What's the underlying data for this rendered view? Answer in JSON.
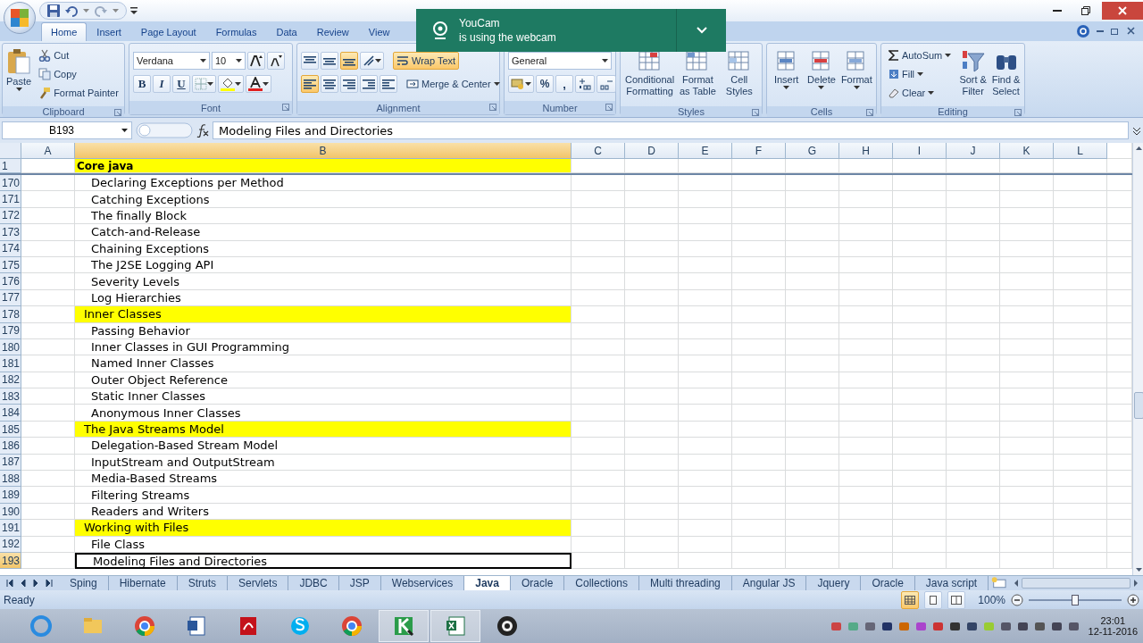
{
  "toast": {
    "title": "YouCam",
    "message": "is using the webcam"
  },
  "ribbon_tabs": [
    {
      "label": "Home",
      "selected": true
    },
    {
      "label": "Insert",
      "selected": false
    },
    {
      "label": "Page Layout",
      "selected": false
    },
    {
      "label": "Formulas",
      "selected": false
    },
    {
      "label": "Data",
      "selected": false
    },
    {
      "label": "Review",
      "selected": false
    },
    {
      "label": "View",
      "selected": false
    }
  ],
  "ribbon": {
    "clipboard": {
      "label": "Clipboard",
      "paste": "Paste",
      "cut": "Cut",
      "copy": "Copy",
      "format_painter": "Format Painter"
    },
    "font": {
      "label": "Font",
      "font_name": "Verdana",
      "font_size": "10",
      "bold": "B",
      "italic": "I",
      "underline": "U"
    },
    "alignment": {
      "label": "Alignment",
      "wrap_text": "Wrap Text",
      "merge_center": "Merge & Center"
    },
    "number": {
      "label": "Number",
      "format": "General",
      "percent": "%",
      "comma": ","
    },
    "styles": {
      "label": "Styles",
      "buttons": [
        [
          "Conditional",
          "Formatting"
        ],
        [
          "Format",
          "as Table"
        ],
        [
          "Cell",
          "Styles"
        ]
      ]
    },
    "cells": {
      "label": "Cells",
      "buttons": [
        "Insert",
        "Delete",
        "Format"
      ]
    },
    "editing": {
      "label": "Editing",
      "autosum": "AutoSum",
      "fill": "Fill",
      "clear": "Clear",
      "buttons": [
        [
          "Sort &",
          "Filter"
        ],
        [
          "Find &",
          "Select"
        ]
      ]
    }
  },
  "formula_bar": {
    "name_box": "B193",
    "formula": "Modeling Files and Directories"
  },
  "columns": [
    {
      "label": "A",
      "selected": false
    },
    {
      "label": "B",
      "selected": true
    },
    {
      "label": "C",
      "selected": false
    },
    {
      "label": "D",
      "selected": false
    },
    {
      "label": "E",
      "selected": false
    },
    {
      "label": "F",
      "selected": false
    },
    {
      "label": "G",
      "selected": false
    },
    {
      "label": "H",
      "selected": false
    },
    {
      "label": "I",
      "selected": false
    },
    {
      "label": "J",
      "selected": false
    },
    {
      "label": "K",
      "selected": false
    },
    {
      "label": "L",
      "selected": false
    }
  ],
  "rows": [
    {
      "number": "1",
      "kind": "title",
      "text": "Core java",
      "selected": false
    },
    {
      "number": "170",
      "kind": "item",
      "text": "Declaring Exceptions per Method",
      "selected": false
    },
    {
      "number": "171",
      "kind": "item",
      "text": "Catching Exceptions",
      "selected": false
    },
    {
      "number": "172",
      "kind": "item",
      "text": "The finally Block",
      "selected": false
    },
    {
      "number": "173",
      "kind": "item",
      "text": "Catch-and-Release",
      "selected": false
    },
    {
      "number": "174",
      "kind": "item",
      "text": "Chaining Exceptions",
      "selected": false
    },
    {
      "number": "175",
      "kind": "item",
      "text": "The J2SE Logging API",
      "selected": false
    },
    {
      "number": "176",
      "kind": "item",
      "text": "Severity Levels",
      "selected": false
    },
    {
      "number": "177",
      "kind": "item",
      "text": "Log Hierarchies",
      "selected": false
    },
    {
      "number": "178",
      "kind": "section",
      "text": "Inner Classes",
      "selected": false
    },
    {
      "number": "179",
      "kind": "item",
      "text": "Passing Behavior",
      "selected": false
    },
    {
      "number": "180",
      "kind": "item",
      "text": "Inner Classes in GUI Programming",
      "selected": false
    },
    {
      "number": "181",
      "kind": "item",
      "text": "Named Inner Classes",
      "selected": false
    },
    {
      "number": "182",
      "kind": "item",
      "text": "Outer Object Reference",
      "selected": false
    },
    {
      "number": "183",
      "kind": "item",
      "text": "Static Inner Classes",
      "selected": false
    },
    {
      "number": "184",
      "kind": "item",
      "text": "Anonymous Inner Classes",
      "selected": false
    },
    {
      "number": "185",
      "kind": "section",
      "text": "The Java Streams Model",
      "selected": false
    },
    {
      "number": "186",
      "kind": "item",
      "text": "Delegation-Based Stream Model",
      "selected": false
    },
    {
      "number": "187",
      "kind": "item",
      "text": "InputStream and OutputStream",
      "selected": false
    },
    {
      "number": "188",
      "kind": "item",
      "text": "Media-Based Streams",
      "selected": false
    },
    {
      "number": "189",
      "kind": "item",
      "text": "Filtering Streams",
      "selected": false
    },
    {
      "number": "190",
      "kind": "item",
      "text": "Readers and Writers",
      "selected": false
    },
    {
      "number": "191",
      "kind": "section",
      "text": "Working with Files",
      "selected": false
    },
    {
      "number": "192",
      "kind": "item",
      "text": "File Class",
      "selected": false
    },
    {
      "number": "193",
      "kind": "item",
      "text": "Modeling Files and Directories",
      "selected": true
    }
  ],
  "sheet_tabs": [
    {
      "label": "Sping",
      "selected": false
    },
    {
      "label": "Hibernate",
      "selected": false
    },
    {
      "label": "Struts",
      "selected": false
    },
    {
      "label": "Servlets",
      "selected": false
    },
    {
      "label": "JDBC",
      "selected": false
    },
    {
      "label": "JSP",
      "selected": false
    },
    {
      "label": "Webservices",
      "selected": false
    },
    {
      "label": "Java",
      "selected": true
    },
    {
      "label": "Oracle",
      "selected": false
    },
    {
      "label": "Collections",
      "selected": false
    },
    {
      "label": "Multi threading",
      "selected": false
    },
    {
      "label": "Angular JS",
      "selected": false
    },
    {
      "label": "Jquery",
      "selected": false
    },
    {
      "label": "Oracle",
      "selected": false
    },
    {
      "label": "Java script",
      "selected": false
    }
  ],
  "status_bar": {
    "status": "Ready",
    "zoom": "100%",
    "zoom_slider": {
      "level": 0.5
    }
  },
  "taskbar": {
    "time": "23:01",
    "date": "12-11-2016"
  }
}
